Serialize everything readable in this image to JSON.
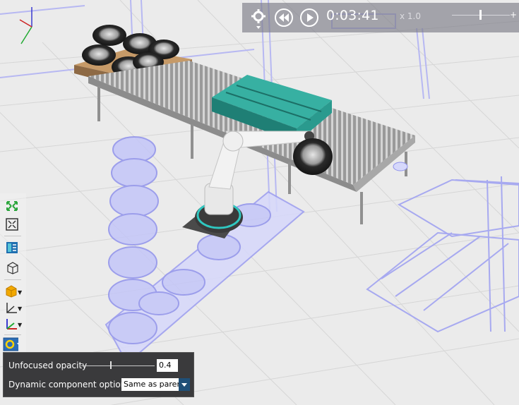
{
  "playback": {
    "time": "0:03:41",
    "speed": "x 1.0",
    "icons": [
      "gear-icon",
      "rewind-icon",
      "play-icon"
    ]
  },
  "toolbar": {
    "icons": [
      "expand-arrows-icon",
      "fit-view-icon",
      "layout-icon",
      "box-outline-icon",
      "solid-box-icon",
      "axes-icon",
      "colored-axes-icon",
      "component-visibility-icon"
    ]
  },
  "popup": {
    "unfocused_opacity_label": "Unfocused opacity",
    "unfocused_opacity_value": "0.4",
    "unfocused_opacity_level": 0.4,
    "dynamic_component_label": "Dynamic component options:",
    "dynamic_component_value": "Same as parent"
  },
  "colors": {
    "panel": "#3a3a3c",
    "accent": "#1f4f77",
    "ghost": "#9a9cf0",
    "pallet_teal": "#2a9a8e",
    "pallet_wood": "#b08860"
  }
}
